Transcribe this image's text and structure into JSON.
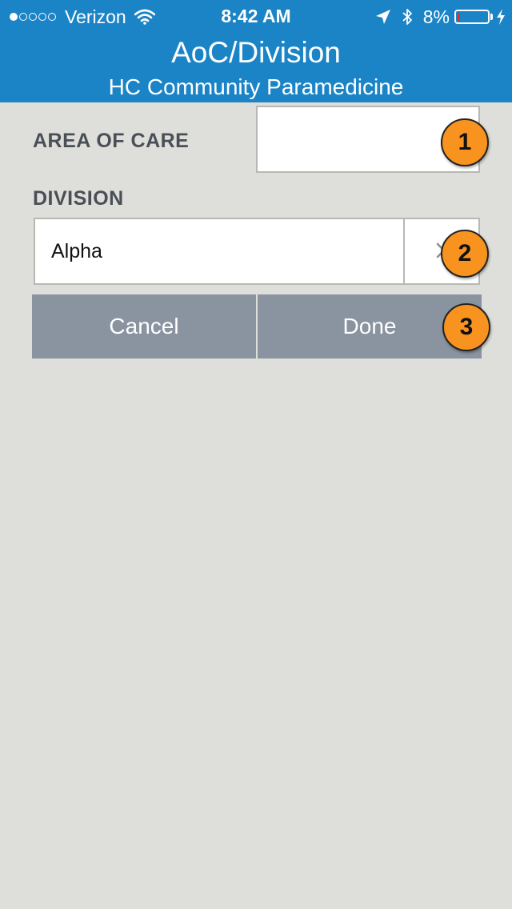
{
  "status_bar": {
    "signal_strength": 1,
    "signal_max": 5,
    "carrier": "Verizon",
    "wifi_icon": "wifi-icon",
    "time": "8:42 AM",
    "location_icon": "location-arrow-icon",
    "bluetooth_icon": "bluetooth-icon",
    "battery_percent": "8%",
    "battery_level": 0.08,
    "battery_color": "#e82a2a",
    "charging_icon": "bolt-icon"
  },
  "header": {
    "title": "AoC/Division",
    "subtitle": "HC Community Paramedicine",
    "background_color": "#1b84c6"
  },
  "form": {
    "area_of_care_label": "AREA OF CARE",
    "area_of_care_value": "",
    "division_label": "DIVISION",
    "division_value": "Alpha",
    "clear_icon": "clear-x-icon"
  },
  "actions": {
    "cancel_label": "Cancel",
    "done_label": "Done",
    "button_color": "#8a93a0"
  },
  "callouts": {
    "marker_1": "1",
    "marker_2": "2",
    "marker_3": "3",
    "marker_color": "#f7931e"
  }
}
